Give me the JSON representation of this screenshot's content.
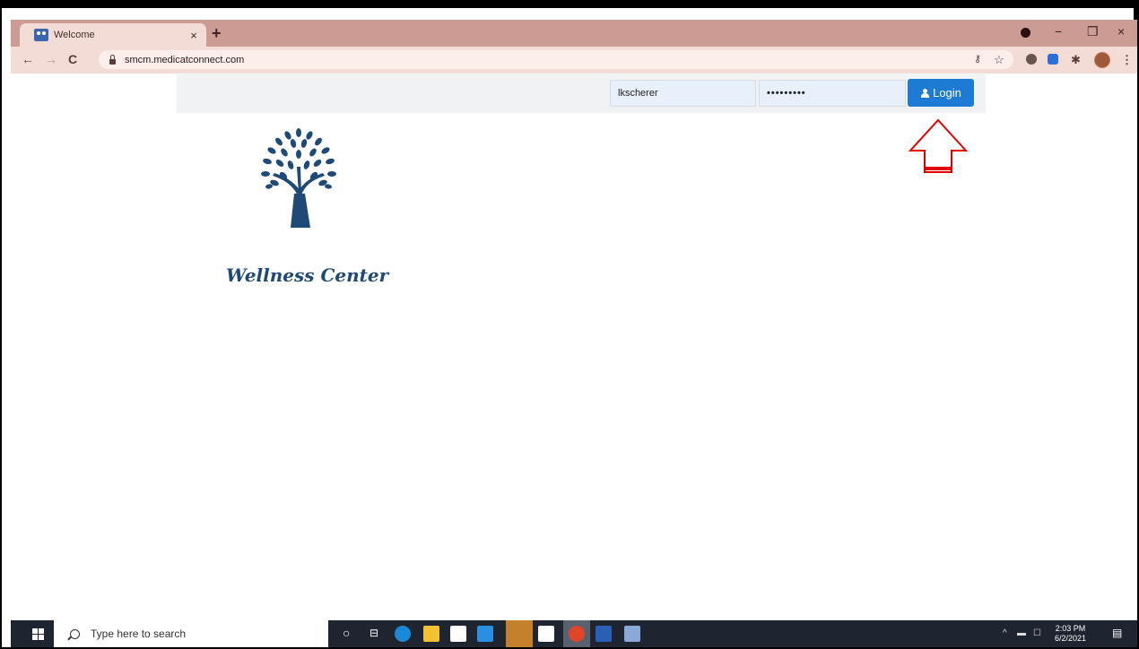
{
  "browser": {
    "tab_title": "Welcome",
    "tab_close": "×",
    "new_tab": "+",
    "url": "smcm.medicatconnect.com",
    "window_controls": {
      "minimize": "−",
      "restore": "❐",
      "close": "×"
    },
    "nav": {
      "back": "←",
      "forward": "→",
      "reload": "C"
    },
    "toolbar_icons": [
      "key-icon",
      "star-icon",
      "extension-icon",
      "zoom-icon",
      "puzzle-icon",
      "profile-avatar",
      "menu-icon"
    ]
  },
  "page": {
    "username_value": "lkscherer",
    "password_value": "•••••••••",
    "login_label": "Login",
    "brand_name": "Wellness Center"
  },
  "taskbar": {
    "search_placeholder": "Type here to search",
    "time": "2:03 PM",
    "date": "6/2/2021"
  },
  "colors": {
    "tab_strip": "#cc9c94",
    "toolbar": "#f4dcd6",
    "login_button": "#1d7bd4",
    "brand": "#1f4a78",
    "annotation_arrow": "#e00000"
  }
}
